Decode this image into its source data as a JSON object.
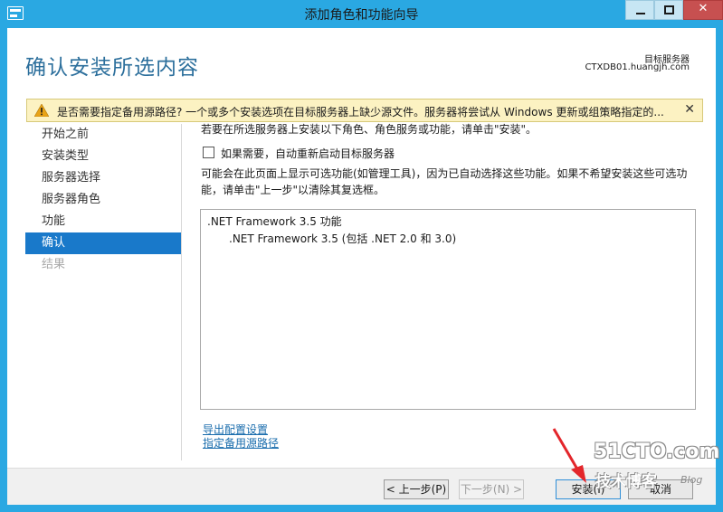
{
  "window": {
    "title": "添加角色和功能向导",
    "close_glyph": "✕"
  },
  "header": {
    "page_title": "确认安装所选内容",
    "target_server_label": "目标服务器",
    "target_server_value": "CTXDB01.huangjh.com"
  },
  "warning": {
    "text": "是否需要指定备用源路径? 一个或多个安装选项在目标服务器上缺少源文件。服务器将尝试从 Windows 更新或组策略指定的...",
    "close_glyph": "✕",
    "icon": "warning-triangle-icon",
    "color": "#fcf2c2"
  },
  "nav": {
    "items": [
      {
        "label": "开始之前",
        "state": "normal"
      },
      {
        "label": "安装类型",
        "state": "normal"
      },
      {
        "label": "服务器选择",
        "state": "normal"
      },
      {
        "label": "服务器角色",
        "state": "normal"
      },
      {
        "label": "功能",
        "state": "normal"
      },
      {
        "label": "确认",
        "state": "active"
      },
      {
        "label": "结果",
        "state": "disabled"
      }
    ],
    "active_color": "#1979ca"
  },
  "content": {
    "description": "若要在所选服务器上安装以下角色、角色服务或功能，请单击\"安装\"。",
    "restart_checkbox_label": "如果需要，自动重新启动目标服务器",
    "restart_checked": false,
    "optional_note": "可能会在此页面上显示可选功能(如管理工具)，因为已自动选择这些功能。如果不希望安装这些可选功能，请单击\"上一步\"以清除其复选框。",
    "features": {
      "main": ".NET Framework 3.5 功能",
      "sub": ".NET Framework 3.5 (包括 .NET 2.0 和 3.0)"
    },
    "links": {
      "export": "导出配置设置",
      "alt_source": "指定备用源路径"
    }
  },
  "footer": {
    "prev": "< 上一步(P)",
    "next": "下一步(N) >",
    "install": "安装(I)",
    "cancel": "取消"
  },
  "watermark": {
    "logo": "51CTO.com",
    "sub": "技术博客",
    "blog": "Blog"
  }
}
